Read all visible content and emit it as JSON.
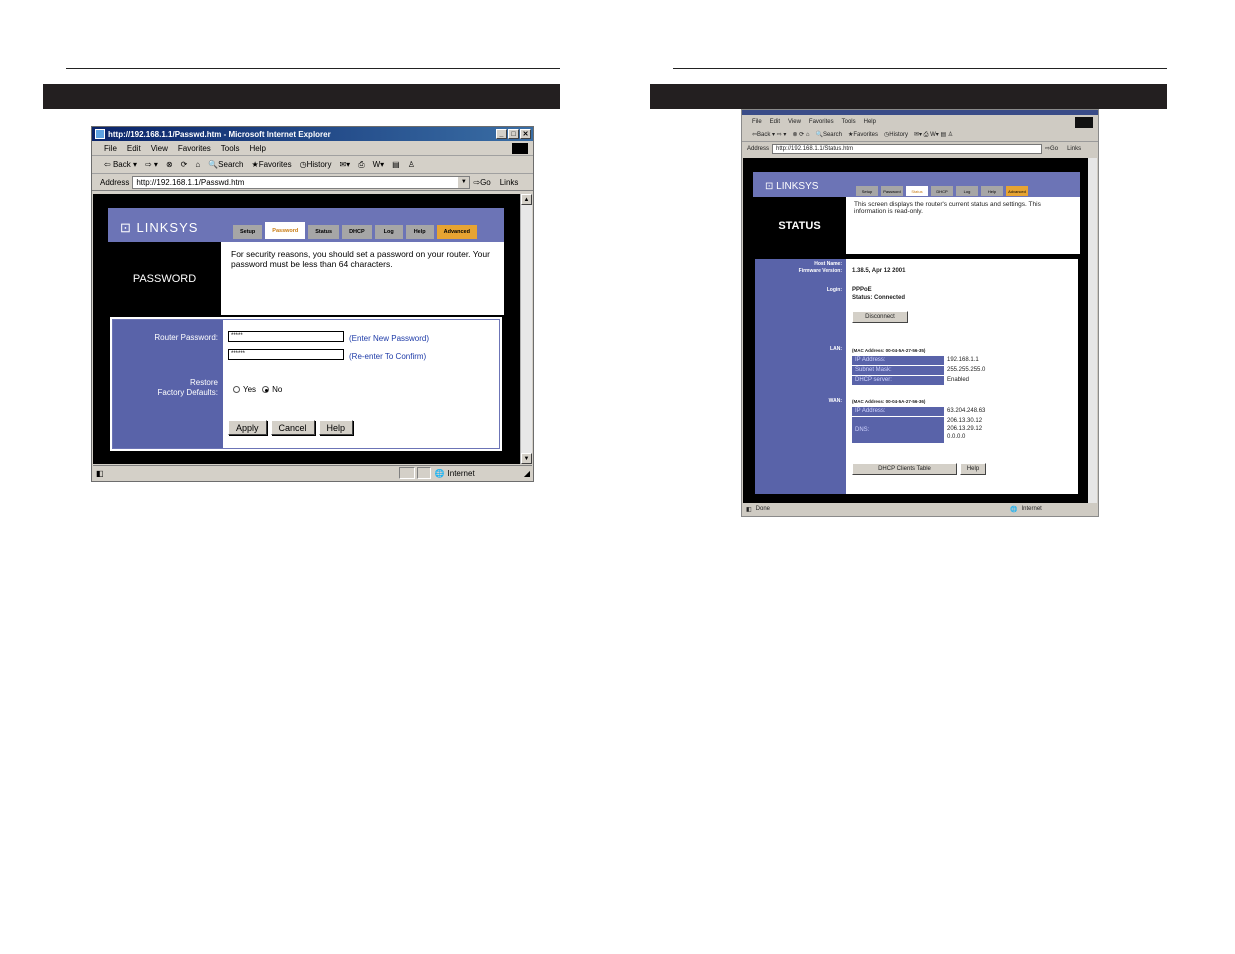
{
  "left": {
    "window_title": "http://192.168.1.1/Passwd.htm - Microsoft Internet Explorer",
    "menu": [
      "File",
      "Edit",
      "View",
      "Favorites",
      "Tools",
      "Help"
    ],
    "toolbar": {
      "back": "Back",
      "search": "Search",
      "favorites": "Favorites",
      "history": "History"
    },
    "address_label": "Address",
    "address_value": "http://192.168.1.1/Passwd.htm",
    "go_label": "Go",
    "links_label": "Links",
    "status_zone": "Internet",
    "brand": "LINKSYS",
    "tabs": [
      "Setup",
      "Password",
      "Status",
      "DHCP",
      "Log",
      "Help",
      "Advanced"
    ],
    "active_tab": "Password",
    "section_title": "PASSWORD",
    "description": "For security reasons, you should set a password on your router. Your password must be less than 64 characters.",
    "router_password_label": "Router Password:",
    "password_value": "*****",
    "confirm_value": "******",
    "enter_hint": "(Enter New Password)",
    "reenter_hint": "(Re-enter To Confirm)",
    "restore_label_1": "Restore",
    "restore_label_2": "Factory Defaults:",
    "radio_yes": "Yes",
    "radio_no": "No",
    "radio_selected": "No",
    "buttons": {
      "apply": "Apply",
      "cancel": "Cancel",
      "help": "Help"
    }
  },
  "right": {
    "menu": [
      "File",
      "Edit",
      "View",
      "Favorites",
      "Tools",
      "Help"
    ],
    "toolbar": {
      "back": "Back",
      "search": "Search",
      "favorites": "Favorites",
      "history": "History"
    },
    "address_label": "Address",
    "address_value": "http://192.168.1.1/Status.htm",
    "go_label": "Go",
    "links_label": "Links",
    "status_left": "Done",
    "status_zone": "Internet",
    "brand": "LINKSYS",
    "tabs": [
      "Setup",
      "Password",
      "Status",
      "DHCP",
      "Log",
      "Help",
      "Advanced"
    ],
    "active_tab": "Status",
    "section_title": "STATUS",
    "description": "This screen displays the router's current status and settings. This information is read-only.",
    "host_name_label": "Host Name:",
    "firmware_label": "Firmware Version:",
    "firmware_value": "1.38.5, Apr 12 2001",
    "login_label": "Login:",
    "login_value": "PPPoE",
    "login_status": "Status: Connected",
    "disconnect_button": "Disconnect",
    "lan_label": "LAN:",
    "lan_mac": "(MAC Address: 00-04-5A-27-56-35)",
    "lan_rows": [
      {
        "k": "IP Address:",
        "v": "192.168.1.1"
      },
      {
        "k": "Subnet Mask:",
        "v": "255.255.255.0"
      },
      {
        "k": "DHCP server:",
        "v": "Enabled"
      }
    ],
    "wan_label": "WAN:",
    "wan_mac": "(MAC Address: 00-04-5A-27-56-36)",
    "wan_ip_label": "IP Address:",
    "wan_ip_value": "63.204.248.63",
    "dns_label": "DNS:",
    "dns_values": [
      "206.13.30.12",
      "206.13.29.12",
      "0.0.0.0"
    ],
    "dhcp_clients_button": "DHCP Clients Table",
    "help_button": "Help"
  }
}
